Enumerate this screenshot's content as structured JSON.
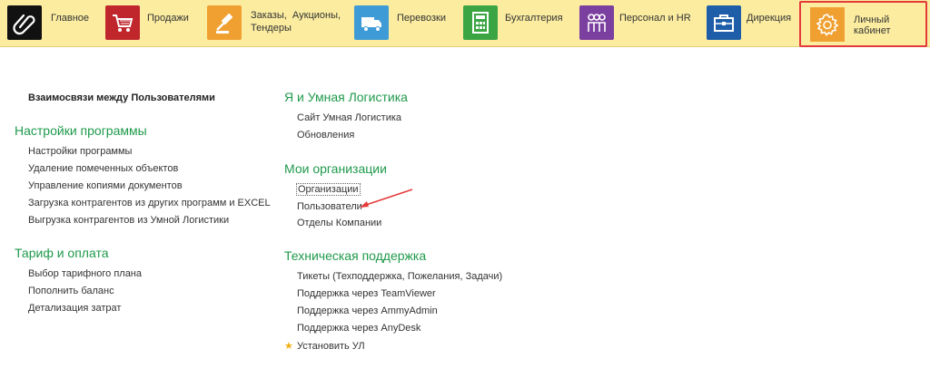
{
  "sections": [
    {
      "label": "Главное",
      "icon": "paperclip-icon",
      "color": "#111111"
    },
    {
      "label": "Продажи",
      "icon": "cart-icon",
      "color": "#c0272d"
    },
    {
      "label": "Заказы,  Аукционы,\nТендеры",
      "icon": "gavel-icon",
      "color": "#f0a030"
    },
    {
      "label": "Перевозки",
      "icon": "truck-icon",
      "color": "#3f9bd6"
    },
    {
      "label": "Бухгалтерия",
      "icon": "calculator-icon",
      "color": "#3ba543"
    },
    {
      "label": "Персонал и HR",
      "icon": "people-icon",
      "color": "#7b3fa0"
    },
    {
      "label": "Дирекция",
      "icon": "briefcase-icon",
      "color": "#1e5ea8"
    },
    {
      "label": "Личный кабинет",
      "icon": "gear-icon",
      "color": "#f0a030"
    }
  ],
  "left": {
    "top_link": "Взаимосвязи между Пользователями",
    "settings": {
      "title": "Настройки программы",
      "items": [
        "Настройки программы",
        "Удаление помеченных объектов",
        "Управление копиями документов",
        "Загрузка контрагентов из других программ и EXCEL",
        "Выгрузка контрагентов из Умной Логистики"
      ]
    },
    "tariff": {
      "title": "Тариф и оплата",
      "items": [
        "Выбор тарифного плана",
        "Пополнить баланс",
        "Детализация затрат"
      ]
    }
  },
  "right": {
    "logistics": {
      "title": "Я и Умная Логистика",
      "items": [
        "Сайт Умная Логистика",
        "Обновления"
      ]
    },
    "orgs": {
      "title": "Мои организации",
      "items": [
        "Организации",
        "Пользователи",
        "Отделы Компании"
      ]
    },
    "support": {
      "title": "Техническая поддержка",
      "items": [
        "Тикеты (Техподдержка, Пожелания, Задачи)",
        "Поддержка через TeamViewer",
        "Поддержка через AmmyAdmin",
        "Поддержка через AnyDesk",
        "Установить УЛ"
      ]
    }
  },
  "colors": {
    "heading": "#1f9a4b",
    "topbar": "#fbeca0",
    "highlight": "#e43a3a",
    "star": "#f0b012"
  }
}
